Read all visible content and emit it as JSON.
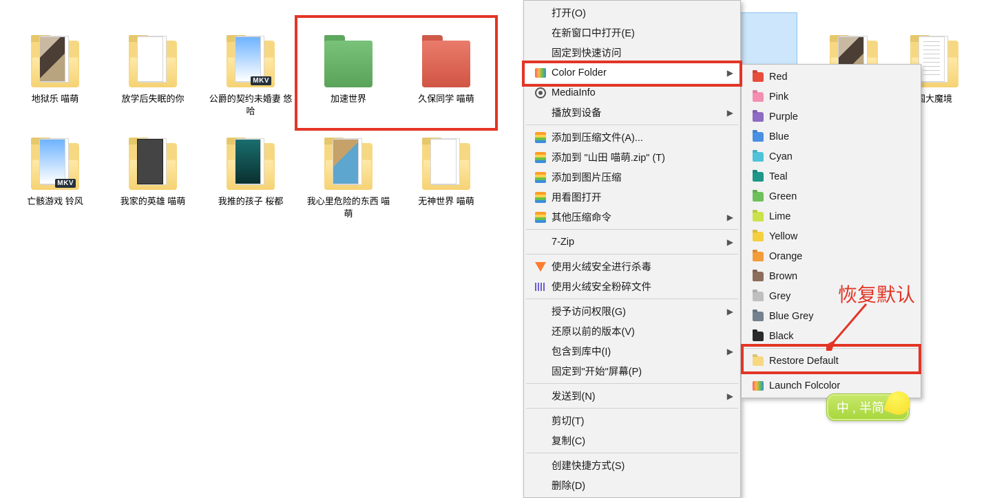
{
  "folders": {
    "row1": [
      {
        "name": "地狱乐 喵萌",
        "preview": "art",
        "mkv": false
      },
      {
        "name": "放学后失眠的你",
        "preview": "plain",
        "mkv": false
      },
      {
        "name": "公爵的契约未婚妻 悠哈",
        "preview": "blue",
        "mkv": true
      },
      {
        "name": "加速世界",
        "color": "green"
      },
      {
        "name": "久保同学 喵萌",
        "color": "red"
      }
    ],
    "row2": [
      {
        "name": "亡骸游戏 铃风",
        "preview": "blue",
        "mkv": true
      },
      {
        "name": "我家的英雄 喵萌",
        "preview": "dark",
        "mkv": false
      },
      {
        "name": "我推的孩子 桜都",
        "preview": "teal",
        "mkv": false
      },
      {
        "name": "我心里危险的东西 喵萌",
        "preview": "photo",
        "mkv": false
      },
      {
        "name": "无神世界 喵萌",
        "preview": "plain",
        "mkv": false
      }
    ],
    "bg_right": [
      {
        "name": "",
        "preview": "art"
      },
      {
        "name": "国大魔境",
        "preview": "lines"
      }
    ]
  },
  "context_menu": {
    "items": [
      {
        "label": "打开(O)"
      },
      {
        "label": "在新窗口中打开(E)"
      },
      {
        "label": "固定到快速访问"
      },
      {
        "label": "Color Folder",
        "icon": "rainbow",
        "sub": true,
        "active": true
      },
      {
        "label": "MediaInfo",
        "icon": "mediainfo"
      },
      {
        "label": "播放到设备",
        "sub": true,
        "sep_after": true
      },
      {
        "label": "添加到压缩文件(A)...",
        "icon": "bz"
      },
      {
        "label": "添加到 \"山田 喵萌.zip\" (T)",
        "icon": "bz"
      },
      {
        "label": "添加到图片压缩",
        "icon": "bz"
      },
      {
        "label": "用看图打开",
        "icon": "bz"
      },
      {
        "label": "其他压缩命令",
        "icon": "bz",
        "sub": true,
        "sep_after": true
      },
      {
        "label": "7-Zip",
        "sub": true,
        "sep_after": true
      },
      {
        "label": "使用火绒安全进行杀毒",
        "icon": "shield"
      },
      {
        "label": "使用火绒安全粉碎文件",
        "icon": "shred",
        "sep_after": true
      },
      {
        "label": "授予访问权限(G)",
        "sub": true
      },
      {
        "label": "还原以前的版本(V)"
      },
      {
        "label": "包含到库中(I)",
        "sub": true
      },
      {
        "label": "固定到\"开始\"屏幕(P)",
        "sep_after": true
      },
      {
        "label": "发送到(N)",
        "sub": true,
        "sep_after": true
      },
      {
        "label": "剪切(T)"
      },
      {
        "label": "复制(C)",
        "sep_after": true
      },
      {
        "label": "创建快捷方式(S)"
      },
      {
        "label": "删除(D)"
      }
    ]
  },
  "color_submenu": {
    "colors": [
      {
        "label": "Red",
        "hex": "#e74c3c"
      },
      {
        "label": "Pink",
        "hex": "#f48fb1"
      },
      {
        "label": "Purple",
        "hex": "#8e6bc4"
      },
      {
        "label": "Blue",
        "hex": "#4a90e2"
      },
      {
        "label": "Cyan",
        "hex": "#4fc3d9"
      },
      {
        "label": "Teal",
        "hex": "#1e9688"
      },
      {
        "label": "Green",
        "hex": "#6ec05b"
      },
      {
        "label": "Lime",
        "hex": "#cbe24a"
      },
      {
        "label": "Yellow",
        "hex": "#f4d03f"
      },
      {
        "label": "Orange",
        "hex": "#f39c3a"
      },
      {
        "label": "Brown",
        "hex": "#8d6e5c"
      },
      {
        "label": "Grey",
        "hex": "#bfbfbf"
      },
      {
        "label": "Blue Grey",
        "hex": "#74828f"
      },
      {
        "label": "Black",
        "hex": "#2a2a2a"
      }
    ],
    "restore": "Restore Default",
    "launch": "Launch Folcolor"
  },
  "annotations": {
    "restore_note": "恢复默认"
  },
  "ime": {
    "label": "中 , 半简"
  }
}
